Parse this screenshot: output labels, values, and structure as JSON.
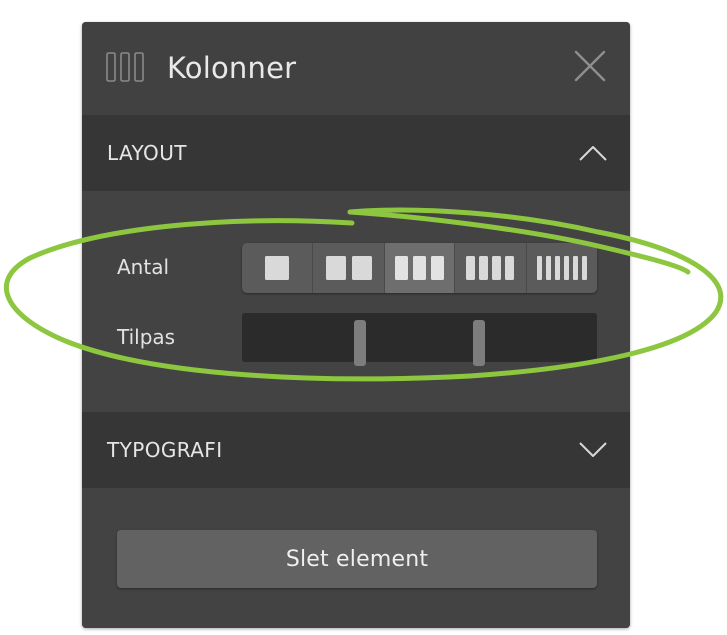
{
  "header": {
    "title": "Kolonner",
    "icon": "columns-icon",
    "close_icon": "close-icon"
  },
  "sections": {
    "layout": {
      "label": "LAYOUT",
      "expanded": true,
      "count_label": "Antal",
      "count_options": [
        1,
        2,
        3,
        4,
        6
      ],
      "count_selected": 3,
      "fit_label": "Tilpas",
      "fit_handle_positions_fraction": [
        0.33,
        0.667
      ]
    },
    "typography": {
      "label": "TYPOGRAFI",
      "expanded": false
    }
  },
  "delete_button": {
    "label": "Slet element"
  },
  "colors": {
    "panel_bg": "#3f3f3f",
    "section_header_bg": "#363636",
    "annotation_stroke": "#8dc63f"
  }
}
